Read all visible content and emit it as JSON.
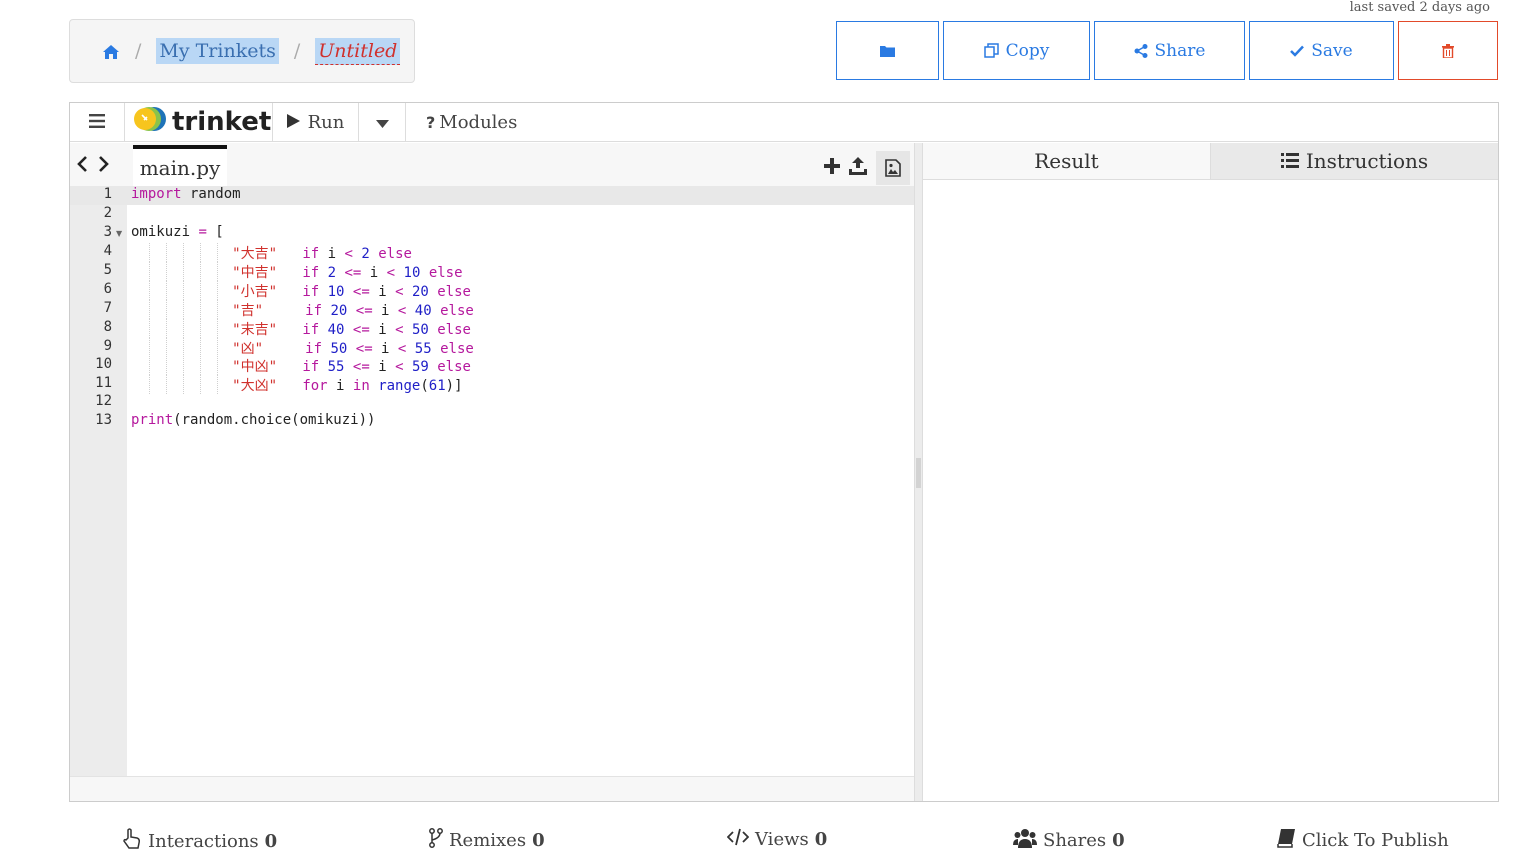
{
  "header": {
    "last_saved": "last saved 2 days ago",
    "breadcrumb": {
      "home_icon": "home-icon",
      "separator": "/",
      "my_trinkets": "My Trinkets",
      "title": "Untitled"
    }
  },
  "actions": {
    "folder_icon": "folder-icon",
    "copy_label": "Copy",
    "share_label": "Share",
    "save_label": "Save",
    "delete_icon": "trash-icon"
  },
  "toolbar": {
    "brand": "trinket",
    "run_label": "Run",
    "modules_label": "Modules"
  },
  "editor": {
    "file_tab": "main.py",
    "line_numbers": [
      "1",
      "2",
      "3",
      "4",
      "5",
      "6",
      "7",
      "8",
      "9",
      "10",
      "11",
      "12",
      "13"
    ]
  },
  "output": {
    "tabs": [
      "Result",
      "Instructions"
    ]
  },
  "footer": {
    "interactions_label": "Interactions",
    "interactions_count": "0",
    "remixes_label": "Remixes",
    "remixes_count": "0",
    "views_label": "Views",
    "views_count": "0",
    "shares_label": "Shares",
    "shares_count": "0",
    "publish_label": "Click To Publish"
  },
  "colors": {
    "accent_blue": "#2a7ae2",
    "danger_red": "#e24a2a",
    "keyword_magenta": "#b5189d",
    "string_red": "#d0312d",
    "number_blue": "#1f1fc7"
  }
}
